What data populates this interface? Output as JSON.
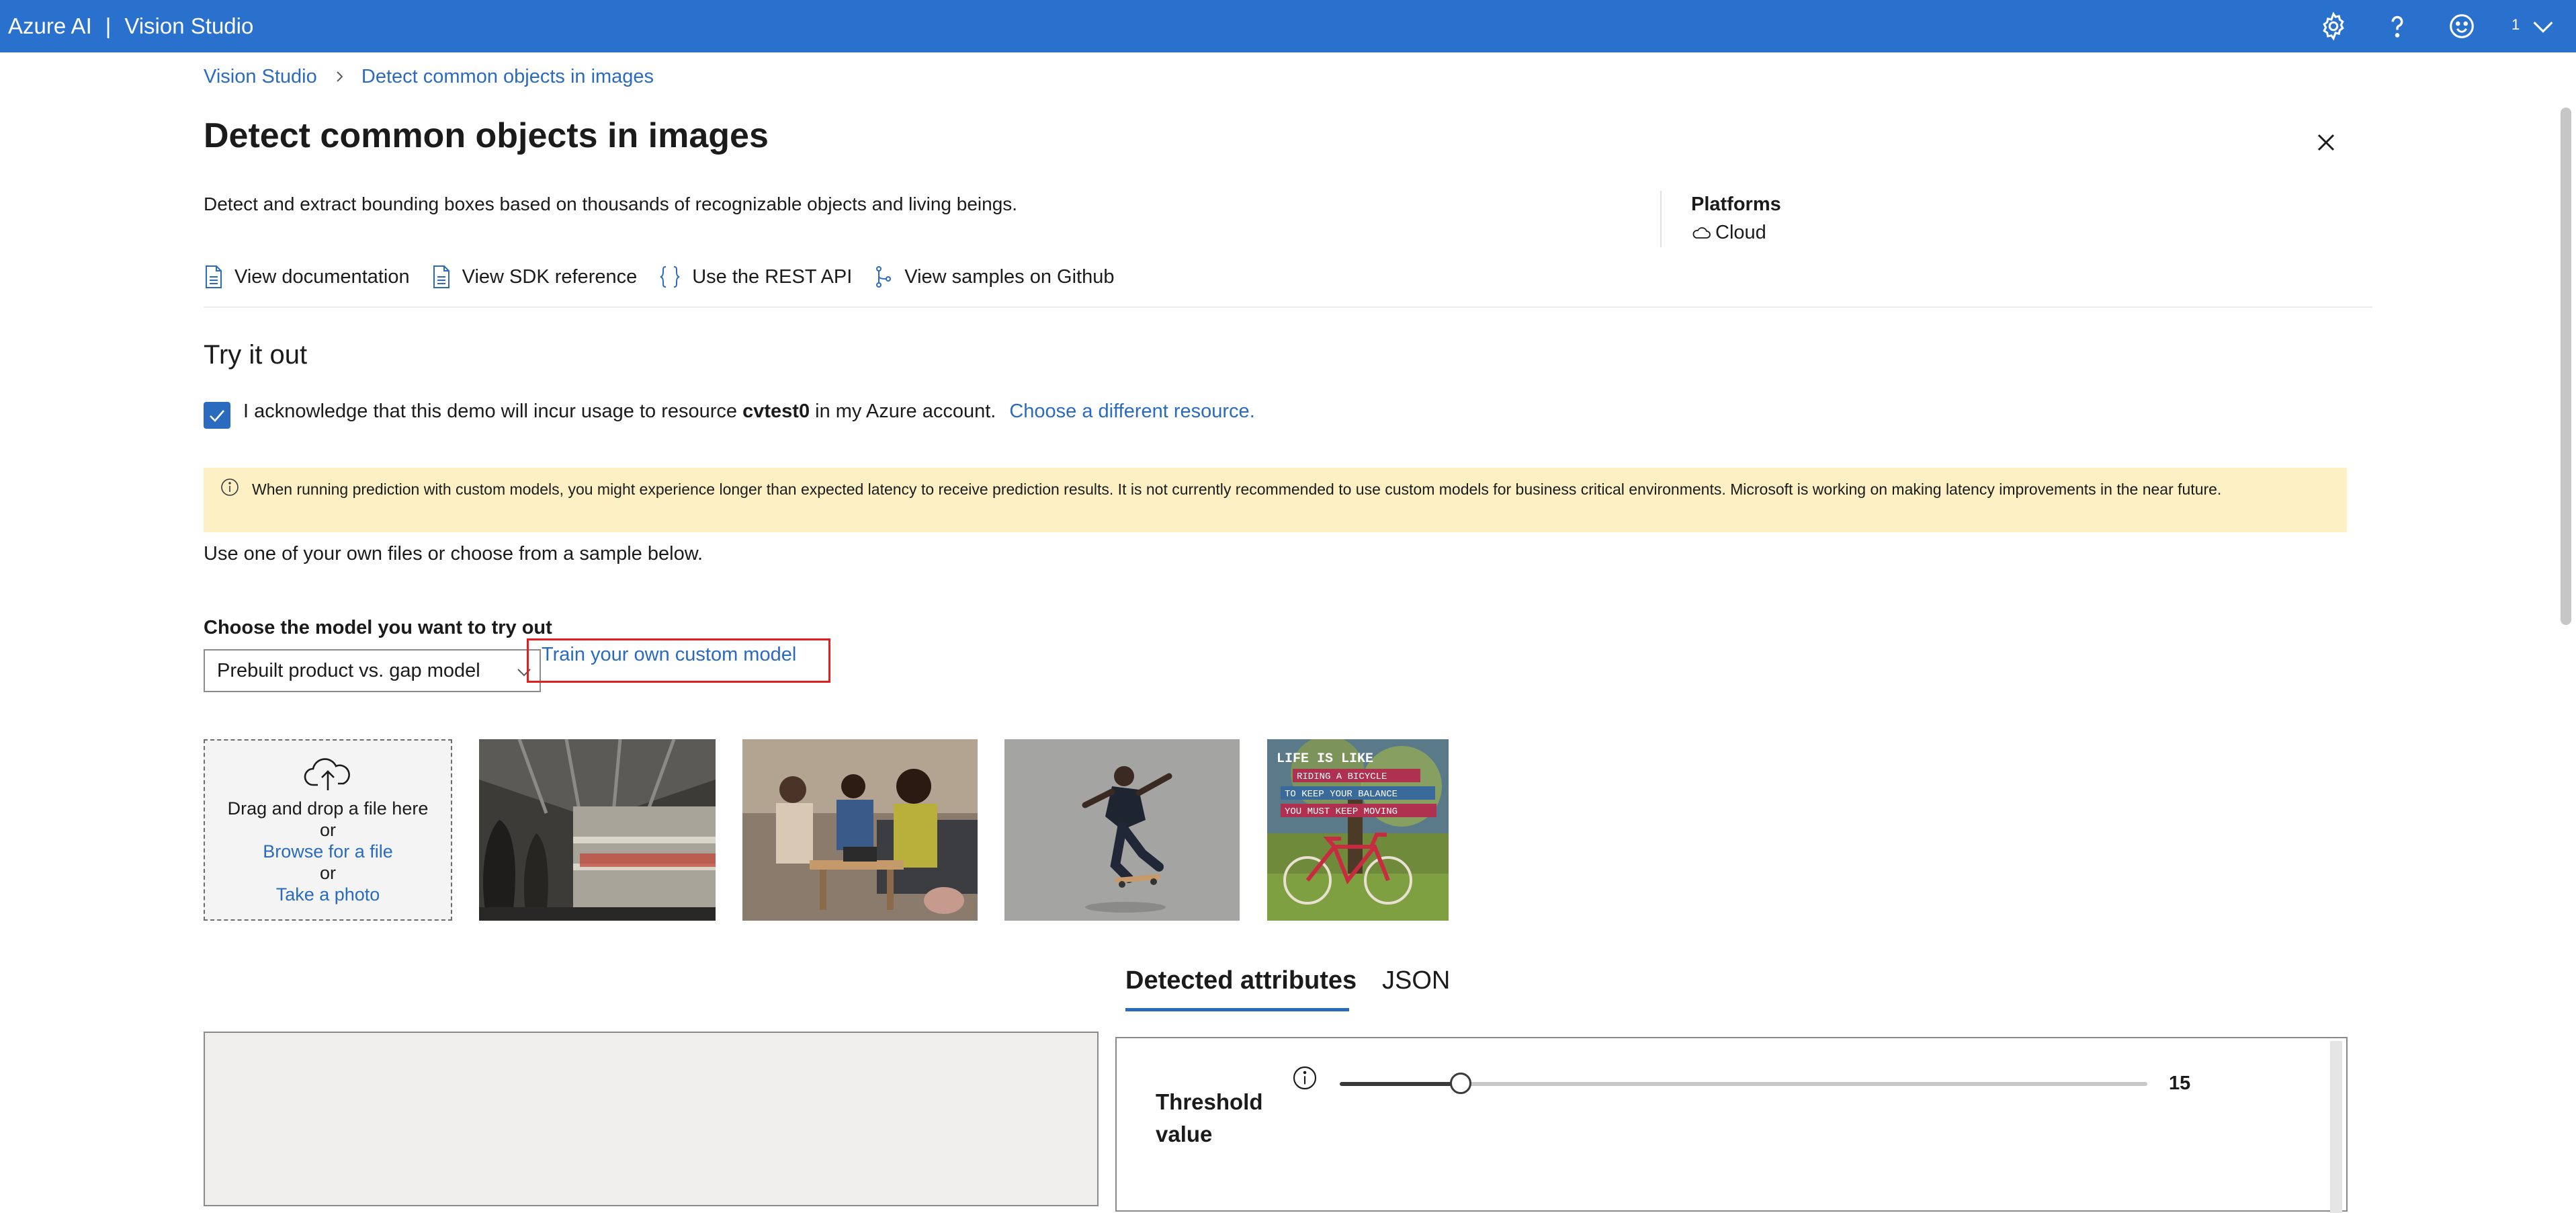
{
  "topbar": {
    "brand": "Azure AI",
    "separator": "|",
    "product": "Vision Studio",
    "badge": "1",
    "icons": [
      "gear-icon",
      "help-icon",
      "smiley-icon",
      "chevron-down-icon"
    ],
    "color": "#2a70cd"
  },
  "breadcrumb": {
    "root": "Vision Studio",
    "current": "Detect common objects in images"
  },
  "page": {
    "title": "Detect common objects in images",
    "description": "Detect and extract bounding boxes based on thousands of recognizable objects and living beings."
  },
  "platforms": {
    "title": "Platforms",
    "value": "Cloud"
  },
  "links": {
    "documentation": "View documentation",
    "sdk": "View SDK reference",
    "rest": "Use the REST API",
    "github": "View samples on Github"
  },
  "try_it": {
    "title": "Try it out",
    "ack_prefix": "I acknowledge that this demo will incur usage to resource ",
    "ack_resource": "cvtest0",
    "ack_suffix": " in my Azure account.",
    "ack_link": "Choose a different resource.",
    "ack_checked": true
  },
  "warning": {
    "text": "When running prediction with custom models, you might experience longer than expected latency to receive prediction results.  It is not currently recommended to use custom models for business critical environments. Microsoft is working on making latency improvements in the near future."
  },
  "use_text": "Use one of your own files or choose from a sample below.",
  "model": {
    "label": "Choose the model you want to try out",
    "selected": "Prebuilt product vs. gap model",
    "custom_link": "Train your own custom model"
  },
  "dropzone": {
    "line1": "Drag and drop a file here",
    "or1": "or",
    "browse": "Browse for a file",
    "or2": "or",
    "photo": "Take a photo"
  },
  "samples": [
    "sample-subway",
    "sample-meeting",
    "sample-skateboarder",
    "sample-bicycle-poster"
  ],
  "poster": {
    "line1": "LIFE IS LIKE",
    "line2": "RIDING A BICYCLE",
    "line3": "TO KEEP YOUR BALANCE",
    "line4": "YOU MUST KEEP MOVING"
  },
  "tabs": {
    "attributes": "Detected attributes",
    "json": "JSON",
    "active": "attributes"
  },
  "threshold": {
    "label": "Threshold value",
    "value": "15",
    "fraction": 0.15
  }
}
